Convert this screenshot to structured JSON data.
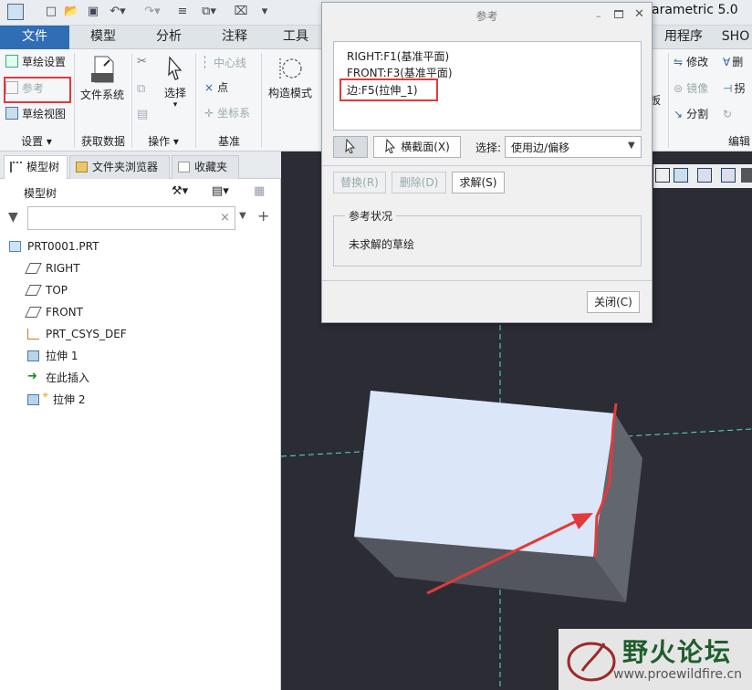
{
  "app": {
    "title": "arametric 5.0"
  },
  "tabs": [
    "文件",
    "模型",
    "分析",
    "注释",
    "工具",
    "用程序",
    "SHO"
  ],
  "ribbon": {
    "setup": {
      "sketch_setup": "草绘设置",
      "reference": "参考",
      "sketch_view": "草绘视图",
      "group": "设置"
    },
    "get_data": {
      "file_system": "文件系统",
      "group": "获取数据"
    },
    "operations": {
      "select": "选择",
      "group": "操作"
    },
    "datum": {
      "centerline": "中心线",
      "point": "点",
      "csys": "坐标系",
      "group": "基准"
    },
    "construction": {
      "label": "构造模式"
    },
    "editing": {
      "modify": "修改",
      "mirror": "镜像",
      "divide": "分割",
      "board_partial": "板",
      "delete_partial": "删",
      "project_partial": "拐",
      "rotate_partial": "",
      "group": "编辑"
    }
  },
  "left_panel": {
    "tabs": [
      "模型树",
      "文件夹浏览器",
      "收藏夹"
    ],
    "tree_header": "模型树",
    "search_placeholder": "",
    "tree": [
      {
        "label": "PRT0001.PRT",
        "icon": "part-icon"
      },
      {
        "label": "RIGHT",
        "icon": "datum-plane-icon"
      },
      {
        "label": "TOP",
        "icon": "datum-plane-icon"
      },
      {
        "label": "FRONT",
        "icon": "datum-plane-icon"
      },
      {
        "label": "PRT_CSYS_DEF",
        "icon": "csys-icon"
      },
      {
        "label": "拉伸 1",
        "icon": "extrude-icon"
      },
      {
        "label": "在此插入",
        "icon": "insert-arrow-icon"
      },
      {
        "label": "拉伸 2",
        "icon": "extrude-new-icon"
      }
    ]
  },
  "dialog": {
    "title": "参考",
    "references": [
      "RIGHT:F1(基准平面)",
      "FRONT:F3(基准平面)",
      "边:F5(拉伸_1)"
    ],
    "cross_section_button": "横截面(X)",
    "select_label": "选择:",
    "select_value": "使用边/偏移",
    "replace_button": "替换(R)",
    "delete_button": "删除(D)",
    "solve_button": "求解(S)",
    "status_legend": "参考状况",
    "status_text": "未求解的草绘",
    "close_button": "关闭(C)"
  },
  "watermark": {
    "title": "野火论坛",
    "url": "www.proewildfire.cn"
  },
  "colors": {
    "highlight_red": "#e23a3a",
    "file_tab_blue": "#2f6db5",
    "viewport_bg": "#2b2c34",
    "part_top": "#dbe6f8",
    "part_side": "#5b5e66",
    "datum_axis": "#55e0d0"
  }
}
